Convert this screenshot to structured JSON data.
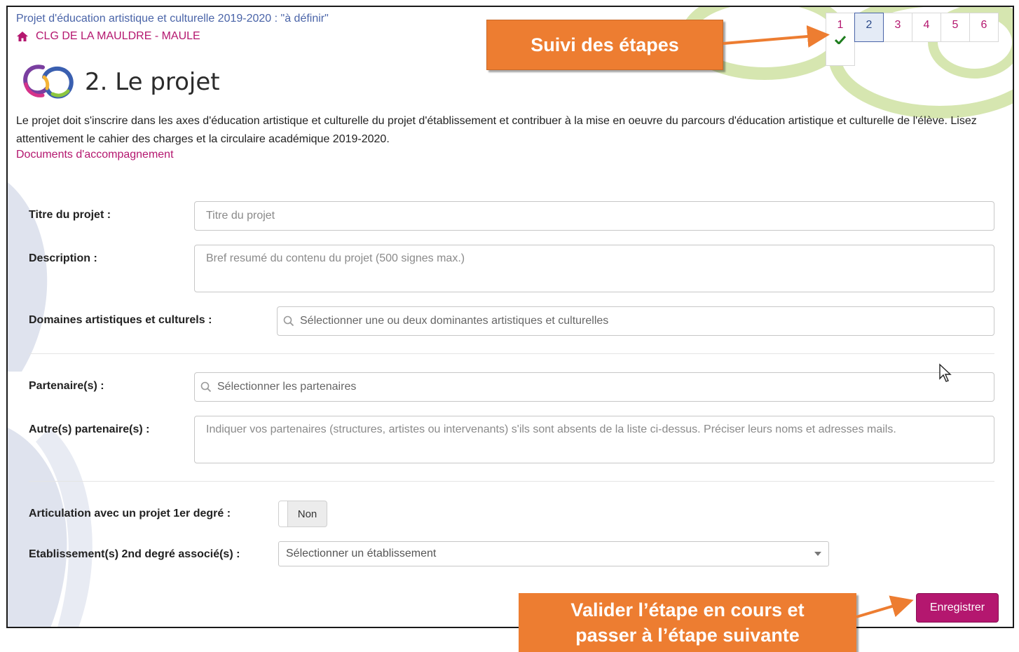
{
  "header": {
    "project_line": "Projet d'éducation artistique et culturelle 2019-2020 : \"à définir\"",
    "school": "CLG DE LA MAULDRE - MAULE"
  },
  "page": {
    "title": "2. Le projet",
    "intro": "Le projet doit s'inscrire dans les axes d'éducation artistique et culturelle du projet d'établissement et contribuer à la mise en oeuvre du parcours d'éducation artistique et culturelle de l'élève. Lisez attentivement le cahier des charges et la circulaire académique 2019-2020.",
    "docs_link": "Documents d'accompagnement"
  },
  "steps": {
    "items": [
      "1",
      "2",
      "3",
      "4",
      "5",
      "6"
    ],
    "active": "2",
    "completed": [
      "1"
    ]
  },
  "form": {
    "title_label": "Titre du projet :",
    "title_placeholder": "Titre du projet",
    "description_label": "Description :",
    "description_placeholder": "Bref resumé du contenu du projet (500 signes max.)",
    "domains_label": "Domaines artistiques et culturels :",
    "domains_placeholder": "Sélectionner une ou deux dominantes artistiques et culturelles",
    "partners_label": "Partenaire(s) :",
    "partners_placeholder": "Sélectionner les partenaires",
    "other_partners_label": "Autre(s) partenaire(s) :",
    "other_partners_placeholder": "Indiquer vos partenaires (structures, artistes ou intervenants) s'ils sont absents de la liste ci-dessus. Préciser leurs noms et adresses mails.",
    "articulation_label": "Articulation avec un projet 1er degré :",
    "articulation_value": "Non",
    "schools_label": "Etablissement(s) 2nd degré associé(s) :",
    "schools_placeholder": "Sélectionner un établissement"
  },
  "actions": {
    "save_label": "Enregistrer"
  },
  "annotations": {
    "steps_callout": "Suivi des étapes",
    "save_callout_line1": "Valider l’étape en cours et",
    "save_callout_line2": "passer à l’étape suivante"
  },
  "colors": {
    "accent": "#b4176f",
    "header_blue": "#4a64a8",
    "callout": "#ed7d31",
    "check_green": "#1e7d1e"
  },
  "icons": [
    "home-icon",
    "logo-icon",
    "search-icon",
    "check-icon",
    "chevron-down-icon",
    "cursor-icon"
  ]
}
